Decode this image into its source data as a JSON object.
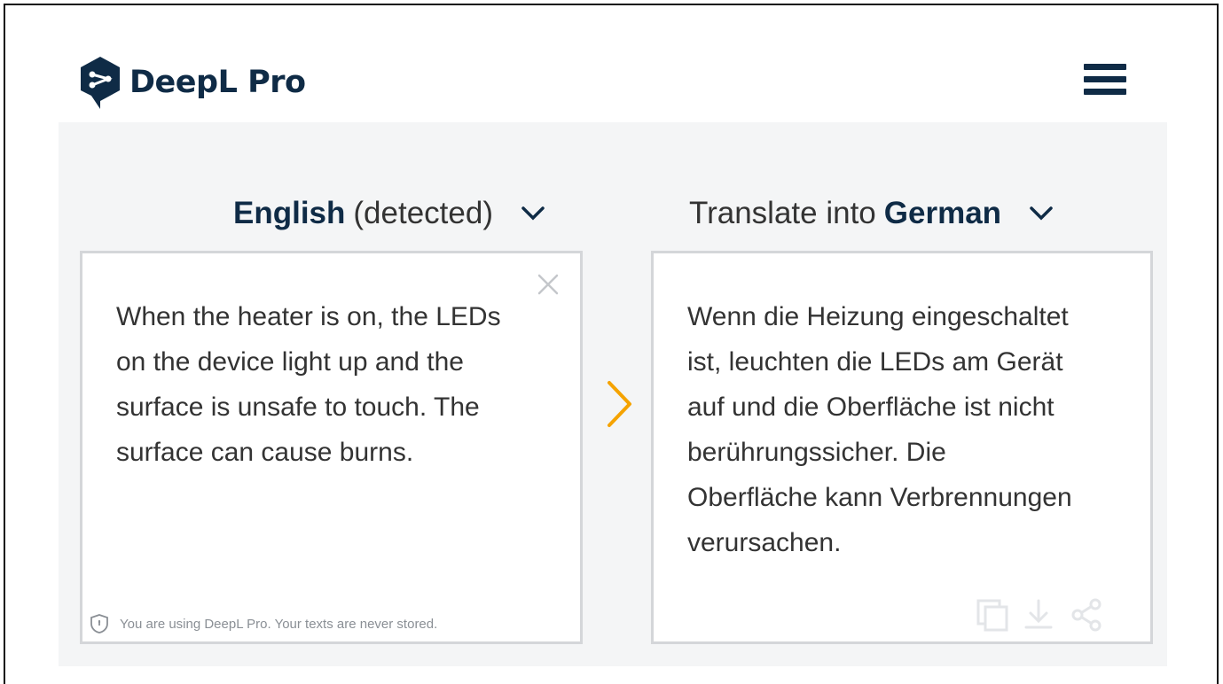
{
  "app": {
    "name": "DeepL Pro"
  },
  "header": {
    "menu_icon": "hamburger-icon"
  },
  "source": {
    "language": "English",
    "detected_suffix": "(detected)",
    "text": "When the heater is on, the LEDs\non the device light up and the\nsurface is unsafe to touch. The\nsurface can cause burns.",
    "notice": "You are using DeepL Pro. Your texts are never stored."
  },
  "target": {
    "prefix": "Translate into",
    "language": "German",
    "text": "Wenn die Heizung eingeschaltet\nist, leuchten die LEDs am Gerät\nauf und die Oberfläche ist nicht\nberührungssicher. Die\nOberfläche kann Verbrennungen\nverursachen."
  },
  "colors": {
    "brand": "#0f2b46",
    "accent_arrow": "#f5a300",
    "panel_bg": "#f4f5f6",
    "box_border": "#d4d6d9"
  },
  "icons": [
    "deepl-logo",
    "hamburger-icon",
    "chevron-down-icon",
    "close-icon",
    "shield-icon",
    "arrow-right-icon",
    "copy-icon",
    "download-icon",
    "share-icon"
  ]
}
